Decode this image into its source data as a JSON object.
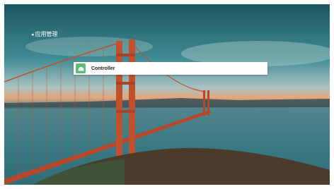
{
  "header": {
    "back_icon": "chevron-left-icon",
    "title": "应用管理"
  },
  "app_list": {
    "items": [
      {
        "label": "Controller",
        "icon": "android-icon",
        "icon_color": "#5fb97a"
      }
    ]
  },
  "wallpaper": {
    "description_colors": {
      "sky_top": "#1f5a66",
      "sunset": "#d9a27a",
      "bridge": "#c0502e"
    }
  }
}
